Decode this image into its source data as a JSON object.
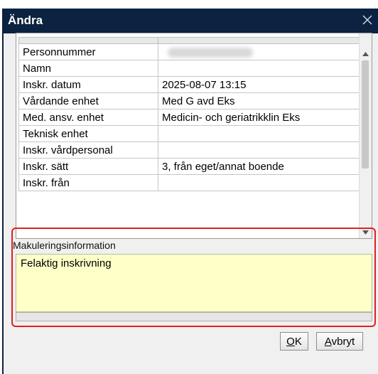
{
  "window": {
    "title": "Ändra"
  },
  "grid": {
    "rows": [
      {
        "label": "Personnummer",
        "value": "",
        "blurred": true
      },
      {
        "label": "Namn",
        "value": ""
      },
      {
        "label": "Inskr. datum",
        "value": "2025-08-07 13:15"
      },
      {
        "label": "Vårdande enhet",
        "value": "Med G avd Eks"
      },
      {
        "label": "Med. ansv. enhet",
        "value": "Medicin- och geriatrikklin Eks"
      },
      {
        "label": "Teknisk enhet",
        "value": ""
      },
      {
        "label": "Inskr. vårdpersonal",
        "value": ""
      },
      {
        "label": "Inskr. sätt",
        "value": "3, från eget/annat boende"
      },
      {
        "label": "Inskr. från",
        "value": ""
      }
    ]
  },
  "makulering": {
    "label": "Makuleringsinformation",
    "text": "Felaktig inskrivning"
  },
  "buttons": {
    "ok_mnemonic": "O",
    "ok_rest": "K",
    "cancel_mnemonic": "A",
    "cancel_rest": "vbryt"
  },
  "colors": {
    "titlebar": "#0b2240",
    "highlight": "#e02020",
    "textarea_bg": "#ffffc8"
  }
}
